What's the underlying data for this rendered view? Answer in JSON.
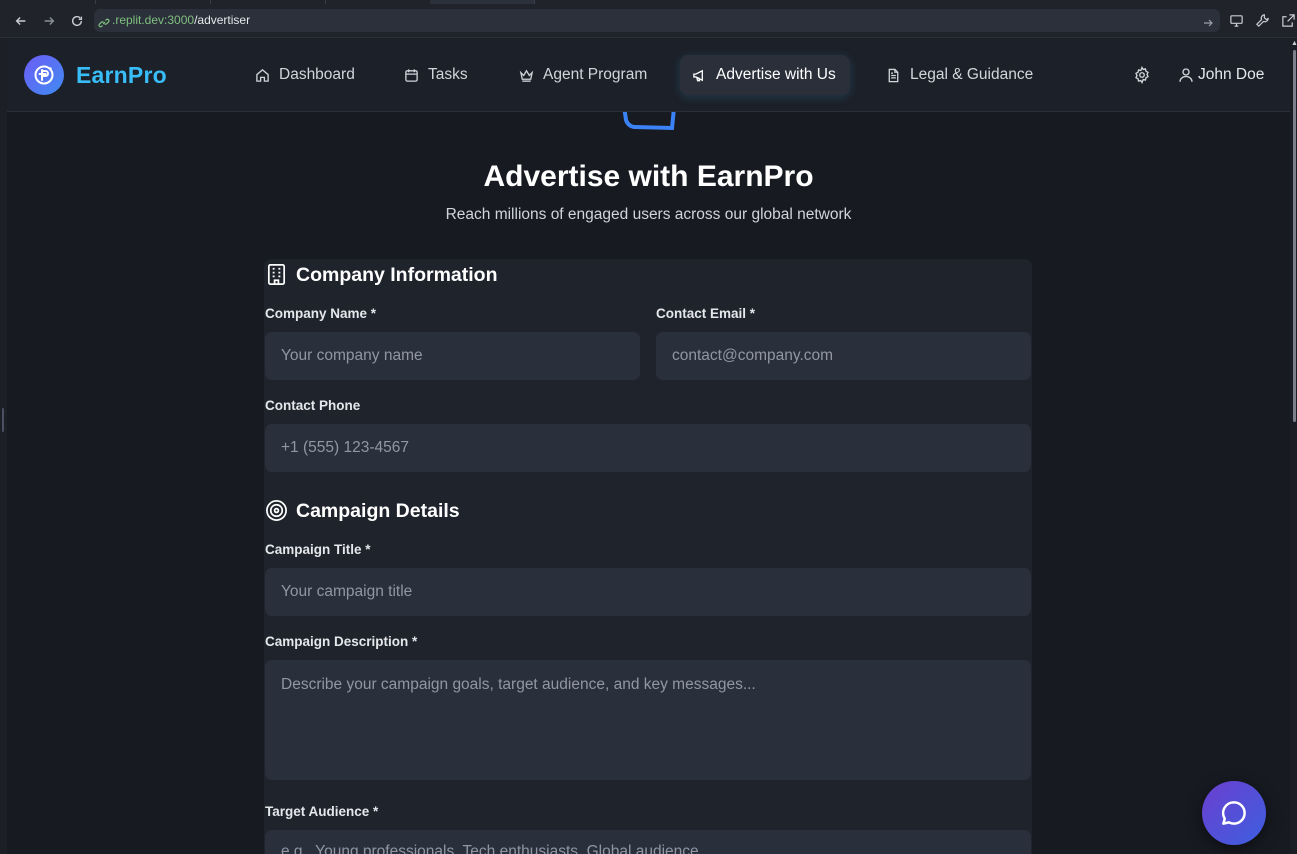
{
  "browser": {
    "url_host": ".replit.dev:3000",
    "url_path": "/advertiser"
  },
  "header": {
    "brand": "EarnPro",
    "nav": [
      {
        "label": "Dashboard",
        "icon": "home-icon"
      },
      {
        "label": "Tasks",
        "icon": "calendar-icon"
      },
      {
        "label": "Agent Program",
        "icon": "crown-icon"
      },
      {
        "label": "Advertise with Us",
        "icon": "megaphone-icon",
        "active": true
      },
      {
        "label": "Legal & Guidance",
        "icon": "document-icon"
      }
    ],
    "user_name": "John Doe"
  },
  "hero": {
    "title": "Advertise with EarnPro",
    "subtitle": "Reach millions of engaged users across our global network"
  },
  "company_section": {
    "title": "Company Information",
    "company_name": {
      "label": "Company Name *",
      "placeholder": "Your company name"
    },
    "contact_email": {
      "label": "Contact Email *",
      "placeholder": "contact@company.com"
    },
    "contact_phone": {
      "label": "Contact Phone",
      "placeholder": "+1 (555) 123-4567"
    }
  },
  "campaign_section": {
    "title": "Campaign Details",
    "campaign_title": {
      "label": "Campaign Title *",
      "placeholder": "Your campaign title"
    },
    "campaign_description": {
      "label": "Campaign Description *",
      "placeholder": "Describe your campaign goals, target audience, and key messages..."
    },
    "target_audience": {
      "label": "Target Audience *",
      "placeholder": "e.g., Young professionals, Tech enthusiasts, Global audience"
    }
  },
  "colors": {
    "brand": "#38bdf8",
    "background": "#171a21",
    "card": "#1f232c",
    "input": "#2a2f3c"
  }
}
